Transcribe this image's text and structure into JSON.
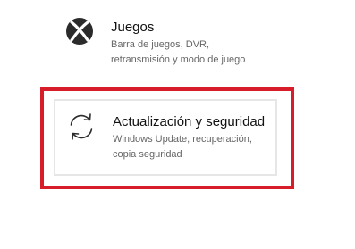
{
  "items": [
    {
      "icon": "xbox-icon",
      "title": "Juegos",
      "description_lines": [
        "Barra de juegos, DVR,",
        "retransmisión y modo de juego"
      ]
    },
    {
      "icon": "sync-arrows-icon",
      "title": "Actualización y seguridad",
      "description_lines": [
        "Windows Update, recuperación,",
        "copia seguridad"
      ]
    }
  ],
  "colors": {
    "highlight_border": "#d71c2a",
    "tile_border": "#e6e6e6",
    "title": "#111111",
    "description": "#666666",
    "icon": "#2b2b2b"
  }
}
